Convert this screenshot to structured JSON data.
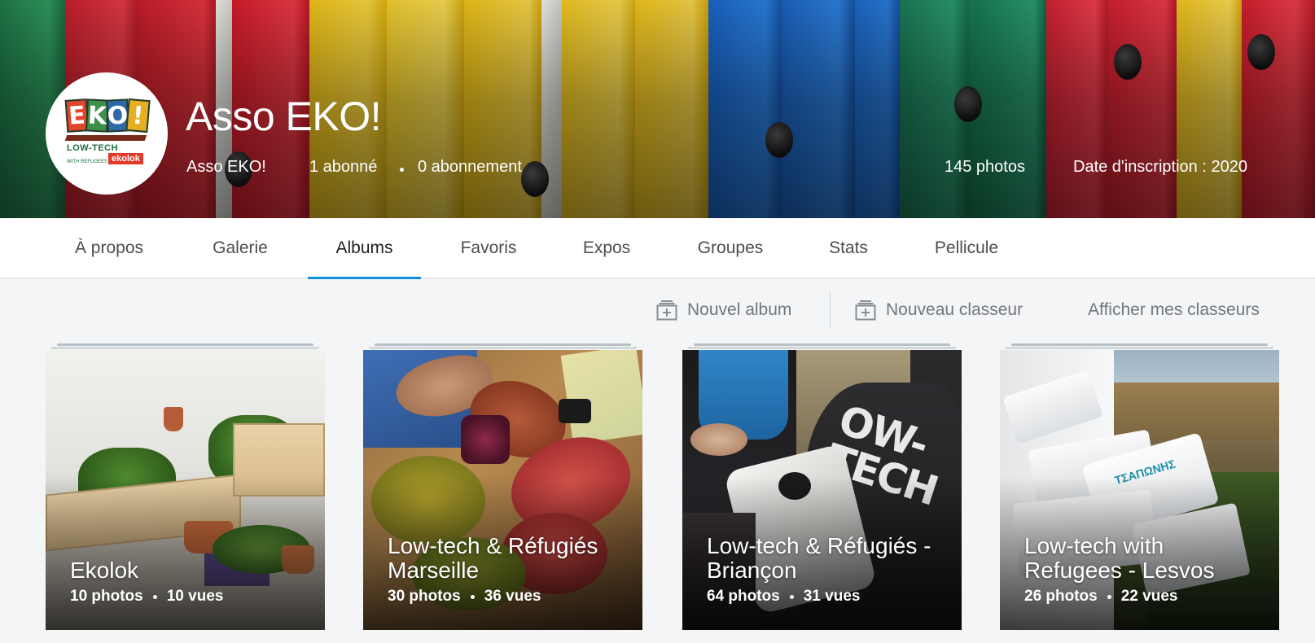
{
  "profile": {
    "name": "Asso EKO!",
    "username": "Asso EKO!",
    "followers": "1 abonné",
    "following": "0 abonnement",
    "photos": "145 photos",
    "joined": "Date d'inscription : 2020",
    "logo_text": {
      "letters": [
        "E",
        "K",
        "O",
        "!"
      ],
      "low_tech": "LOW-TECH",
      "refugees": "WITH REFUGEES",
      "ekolok": "ekolok"
    }
  },
  "tabs": [
    {
      "label": "À propos"
    },
    {
      "label": "Galerie"
    },
    {
      "label": "Albums"
    },
    {
      "label": "Favoris"
    },
    {
      "label": "Expos"
    },
    {
      "label": "Groupes"
    },
    {
      "label": "Stats"
    },
    {
      "label": "Pellicule"
    }
  ],
  "active_tab": "Albums",
  "toolbar": {
    "new_album": "Nouvel album",
    "new_folder": "Nouveau classeur",
    "show_folders": "Afficher mes classeurs"
  },
  "albums": [
    {
      "title": "Ekolok",
      "photos": "10 photos",
      "views": "10 vues"
    },
    {
      "title": "Low-tech & Réfugiés Marseille",
      "photos": "30 photos",
      "views": "36 vues"
    },
    {
      "title": "Low-tech & Réfugiés - Briançon",
      "photos": "64 photos",
      "views": "31 vues"
    },
    {
      "title": "Low-tech with Refugees - Lesvos",
      "photos": "26 photos",
      "views": "22 vues"
    }
  ],
  "colors": {
    "accent": "#128fdc",
    "background": "#f3f5f6",
    "tab_text": "#4a4d50"
  },
  "icons": {
    "new_album": "add-album-icon",
    "new_folder": "add-folder-icon"
  }
}
